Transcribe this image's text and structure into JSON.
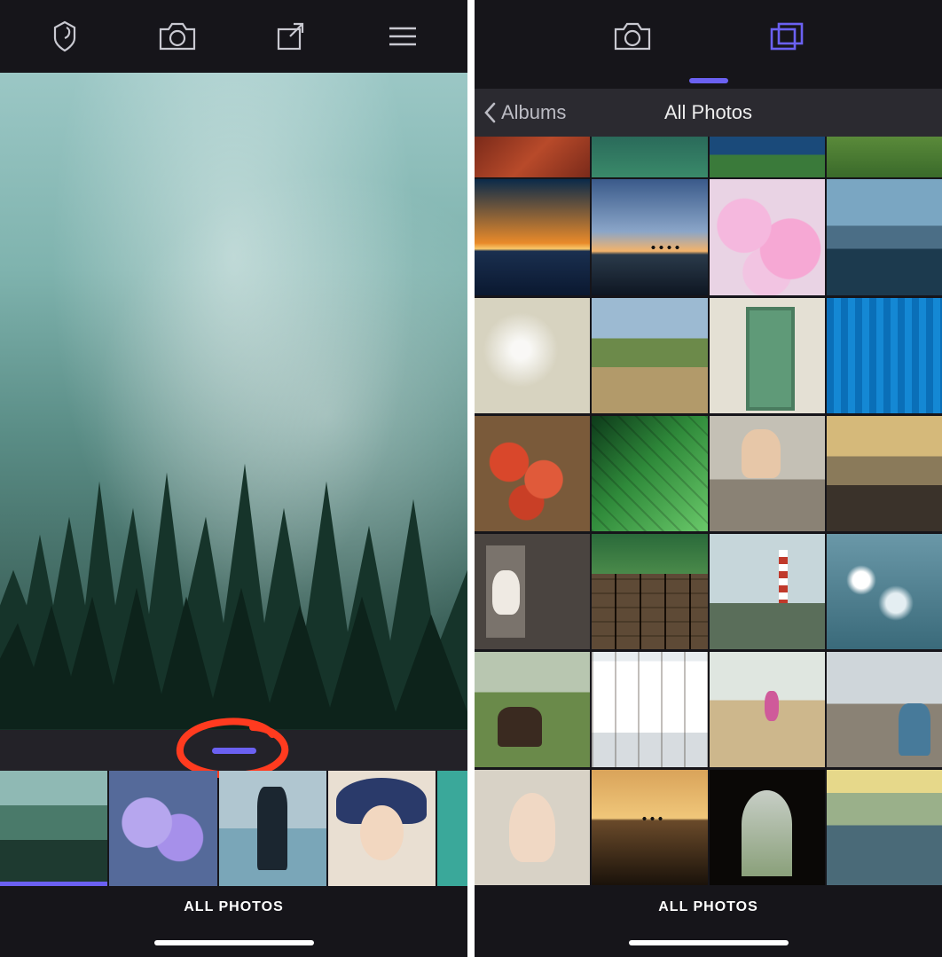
{
  "colors": {
    "accent": "#6b61f2"
  },
  "left": {
    "toolbar": {
      "icons": [
        "logo-icon",
        "camera-icon",
        "share-icon",
        "menu-icon"
      ]
    },
    "handle_label": "drag-handle",
    "bottom_label": "ALL PHOTOS",
    "thumbs": [
      {
        "name": "thumb-forest",
        "selected": true
      },
      {
        "name": "thumb-purple-flowers",
        "selected": false
      },
      {
        "name": "thumb-man-standing",
        "selected": false
      },
      {
        "name": "thumb-woman-hat",
        "selected": false
      },
      {
        "name": "thumb-teal",
        "selected": false
      }
    ]
  },
  "right": {
    "toolbar": {
      "icons": [
        "camera-icon",
        "gallery-icon"
      ],
      "active": "gallery-icon"
    },
    "nav": {
      "back_label": "Albums",
      "title": "All Photos"
    },
    "bottom_label": "ALL PHOTOS"
  }
}
